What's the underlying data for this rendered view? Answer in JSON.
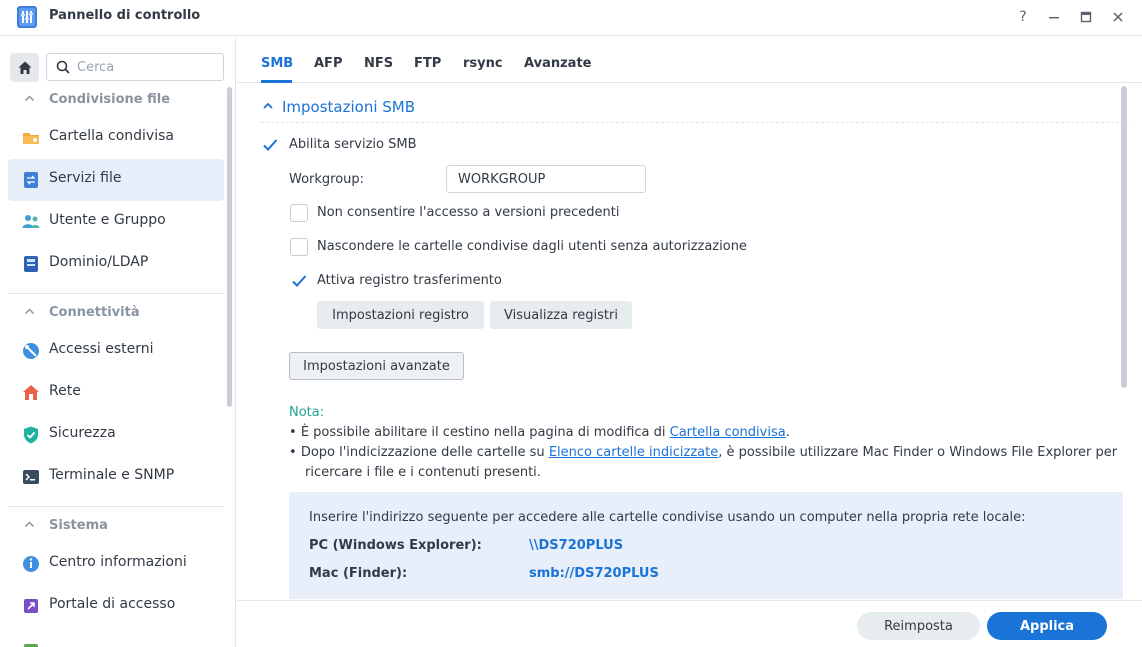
{
  "window": {
    "title": "Pannello di controllo"
  },
  "search": {
    "placeholder": "Cerca"
  },
  "sidebar": {
    "sections": [
      {
        "label": "Condivisione file",
        "items": [
          "Cartella condivisa",
          "Servizi file",
          "Utente e Gruppo",
          "Dominio/LDAP"
        ]
      },
      {
        "label": "Connettività",
        "items": [
          "Accessi esterni",
          "Rete",
          "Sicurezza",
          "Terminale e SNMP"
        ]
      },
      {
        "label": "Sistema",
        "items": [
          "Centro informazioni",
          "Portale di accesso"
        ]
      }
    ],
    "active_item": "Servizi file"
  },
  "tabs": [
    "SMB",
    "AFP",
    "NFS",
    "FTP",
    "rsync",
    "Avanzate"
  ],
  "smb": {
    "section_title": "Impostazioni SMB",
    "enable_label": "Abilita servizio SMB",
    "enable_checked": true,
    "workgroup_label": "Workgroup:",
    "workgroup_value": "WORKGROUP",
    "opt_old_versions": "Non consentire l'accesso a versioni precedenti",
    "opt_hide_shares": "Nascondere le cartelle condivise dagli utenti senza autorizzazione",
    "opt_transfer_log": "Attiva registro trasferimento",
    "log_settings_button": "Impostazioni registro",
    "view_logs_button": "Visualizza registri",
    "advanced_button": "Impostazioni avanzate"
  },
  "note": {
    "title": "Nota:",
    "bullet1_pre": "È possibile abilitare il cestino nella pagina di modifica di ",
    "bullet1_link": "Cartella condivisa",
    "bullet1_post": ".",
    "bullet2_pre": "Dopo l'indicizzazione delle cartelle su ",
    "bullet2_link": "Elenco cartelle indicizzate",
    "bullet2_post": ", è possibile utilizzare Mac Finder o Windows File Explorer per",
    "bullet2_line2": "ricercare i file e i contenuti presenti."
  },
  "info": {
    "lead": "Inserire l'indirizzo seguente per accedere alle cartelle condivise usando un computer nella propria rete locale:",
    "pc_label": "PC (Windows Explorer):",
    "pc_value": "\\\\DS720PLUS",
    "mac_label": "Mac (Finder):",
    "mac_value": "smb://DS720PLUS"
  },
  "footer": {
    "reset": "Reimposta",
    "apply": "Applica"
  },
  "colors": {
    "accent": "#1a73d6",
    "note": "#21a392"
  }
}
